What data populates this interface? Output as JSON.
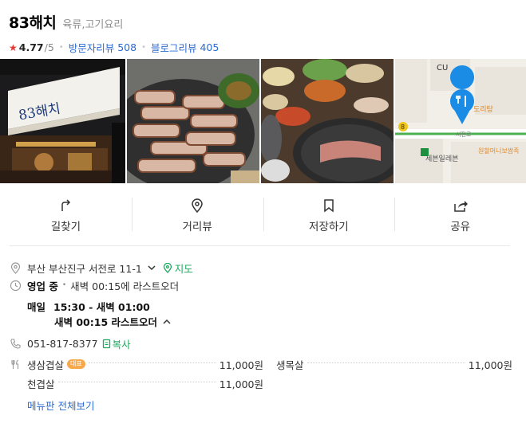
{
  "place": {
    "name": "83해치",
    "category": "육류,고기요리",
    "rating": "4.77",
    "rating_max": "/5",
    "visitor_reviews_label": "방문자리뷰",
    "visitor_reviews_count": "508",
    "blog_reviews_label": "블로그리뷰",
    "blog_reviews_count": "405"
  },
  "photos": {
    "p1_sign": "83해치",
    "map_cu": "CU",
    "map_label1": "도리탕",
    "map_road": "서전로",
    "map_store": "세븐일레븐",
    "map_label2": "원할머니보쌈족",
    "map_route": "8"
  },
  "actions": [
    {
      "label": "길찾기",
      "icon": "directions-icon"
    },
    {
      "label": "거리뷰",
      "icon": "location-pin-icon"
    },
    {
      "label": "저장하기",
      "icon": "bookmark-icon"
    },
    {
      "label": "공유",
      "icon": "share-icon"
    }
  ],
  "info": {
    "address": "부산 부산진구 서전로 11-1",
    "map_link": "지도",
    "status": "영업 중",
    "last_order": "새벽 00:15에 라스트오더",
    "hours_day": "매일",
    "hours_time": "15:30 - 새벽 01:00",
    "hours_last_order": "새벽 00:15 라스트오더",
    "phone": "051-817-8377",
    "copy": "복사"
  },
  "menu": {
    "items": [
      {
        "name": "생삼겹살",
        "badge": "대표",
        "price": "11,000원"
      },
      {
        "name": "생목살",
        "badge": "",
        "price": "11,000원"
      },
      {
        "name": "천겹살",
        "badge": "",
        "price": "11,000원"
      }
    ],
    "view_all": "메뉴판 전체보기"
  }
}
